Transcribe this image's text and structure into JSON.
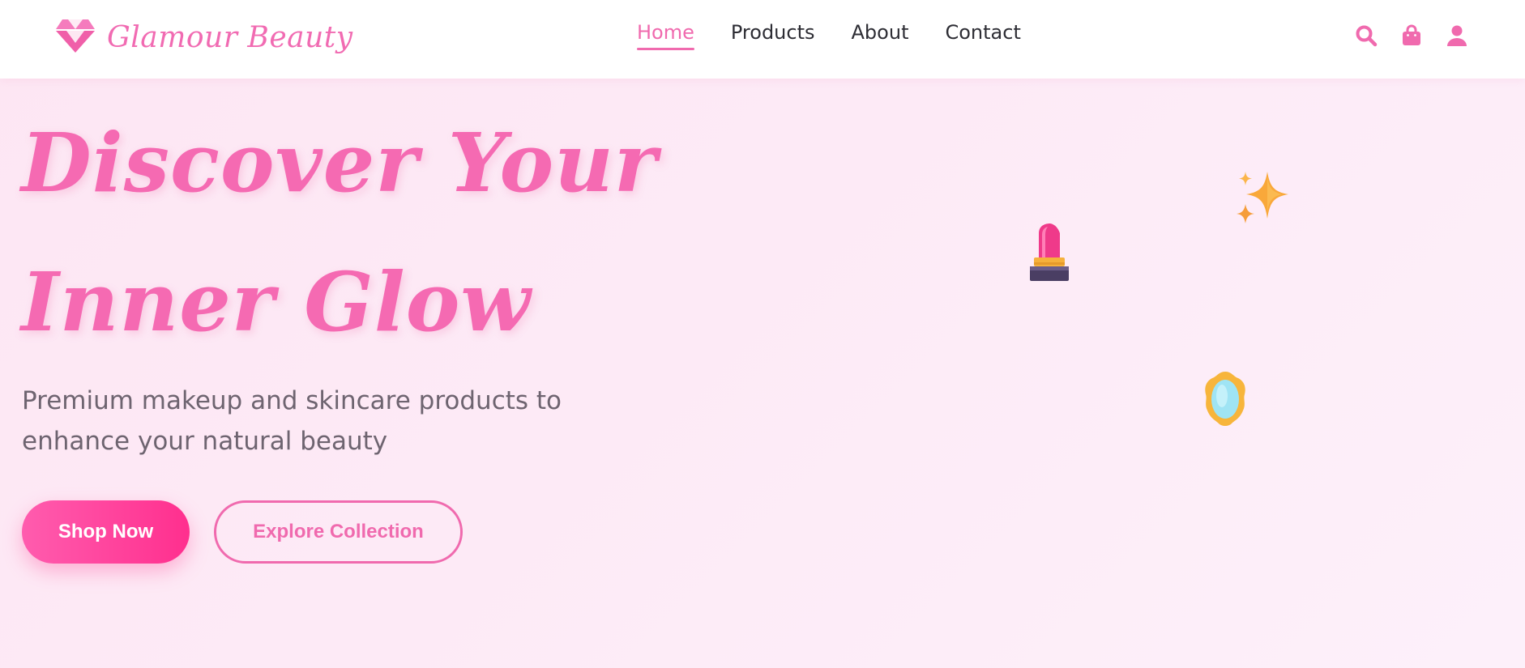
{
  "brand": {
    "name": "Glamour Beauty",
    "logo_icon": "gem-icon",
    "accent_color": "#f06aae"
  },
  "nav": {
    "items": [
      {
        "label": "Home",
        "active": true
      },
      {
        "label": "Products",
        "active": false
      },
      {
        "label": "About",
        "active": false
      },
      {
        "label": "Contact",
        "active": false
      }
    ]
  },
  "header_icons": [
    "search-icon",
    "shopping-bag-icon",
    "user-icon"
  ],
  "hero": {
    "title": "Discover Your Inner Glow",
    "subtitle": "Premium makeup and skincare products to enhance your natural beauty",
    "primary_button": "Shop Now",
    "secondary_button": "Explore Collection",
    "decorations": [
      "sparkles-icon",
      "lipstick-icon",
      "mirror-icon"
    ]
  }
}
